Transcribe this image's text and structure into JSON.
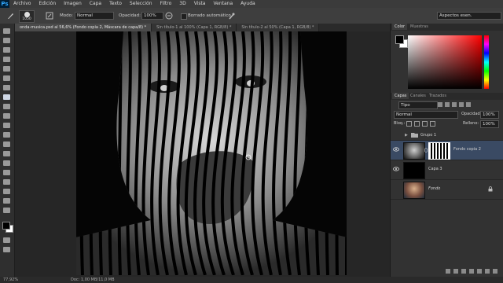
{
  "app": {
    "logo": "Ps"
  },
  "menubar": {
    "items": [
      "Archivo",
      "Edición",
      "Imagen",
      "Capa",
      "Texto",
      "Selección",
      "Filtro",
      "3D",
      "Vista",
      "Ventana",
      "Ayuda"
    ]
  },
  "options": {
    "brush_size": "1050",
    "mode_label": "Modo:",
    "mode_value": "Normal",
    "opacity_label": "Opacidad:",
    "opacity_value": "100%",
    "auto_erase_label": "Borrado automático",
    "workspace": "Aspectos esen."
  },
  "tabs": [
    {
      "label": "onda-musica.psd al 56,6% (Fondo copia 2, Máscara de capa/8) *",
      "active": true
    },
    {
      "label": "Sin título-1 al 100% (Capa 1, RGB/8) *",
      "active": false
    },
    {
      "label": "Sin título-2 al 50% (Capa 1, RGB/8) *",
      "active": false
    }
  ],
  "status": {
    "zoom": "77,92%",
    "doc": "Doc: 1,00 MB/11,0 MB"
  },
  "color_panel": {
    "tabs": [
      "Color",
      "Muestras"
    ]
  },
  "layers_panel": {
    "tabs": [
      "Capas",
      "Canales",
      "Trazados"
    ],
    "filter_value": "Tipo",
    "blend_value": "Normal",
    "opacity_label": "Opacidad:",
    "opacity_value": "100%",
    "lock_label": "Bloq.:",
    "fill_label": "Relleno:",
    "fill_value": "100%",
    "layers": [
      {
        "name": "Grupo 1",
        "type": "group",
        "visible": false
      },
      {
        "name": "Fondo copia 2",
        "type": "masked",
        "visible": true,
        "selected": true
      },
      {
        "name": "Capa 3",
        "type": "black",
        "visible": true
      },
      {
        "name": "Fondo",
        "type": "photo",
        "visible": false,
        "locked": true
      }
    ]
  },
  "colors": {
    "accent": "#31a8ff",
    "foreground": "#000000",
    "background": "#ffffff",
    "selected_layer": "#3a4a63"
  }
}
